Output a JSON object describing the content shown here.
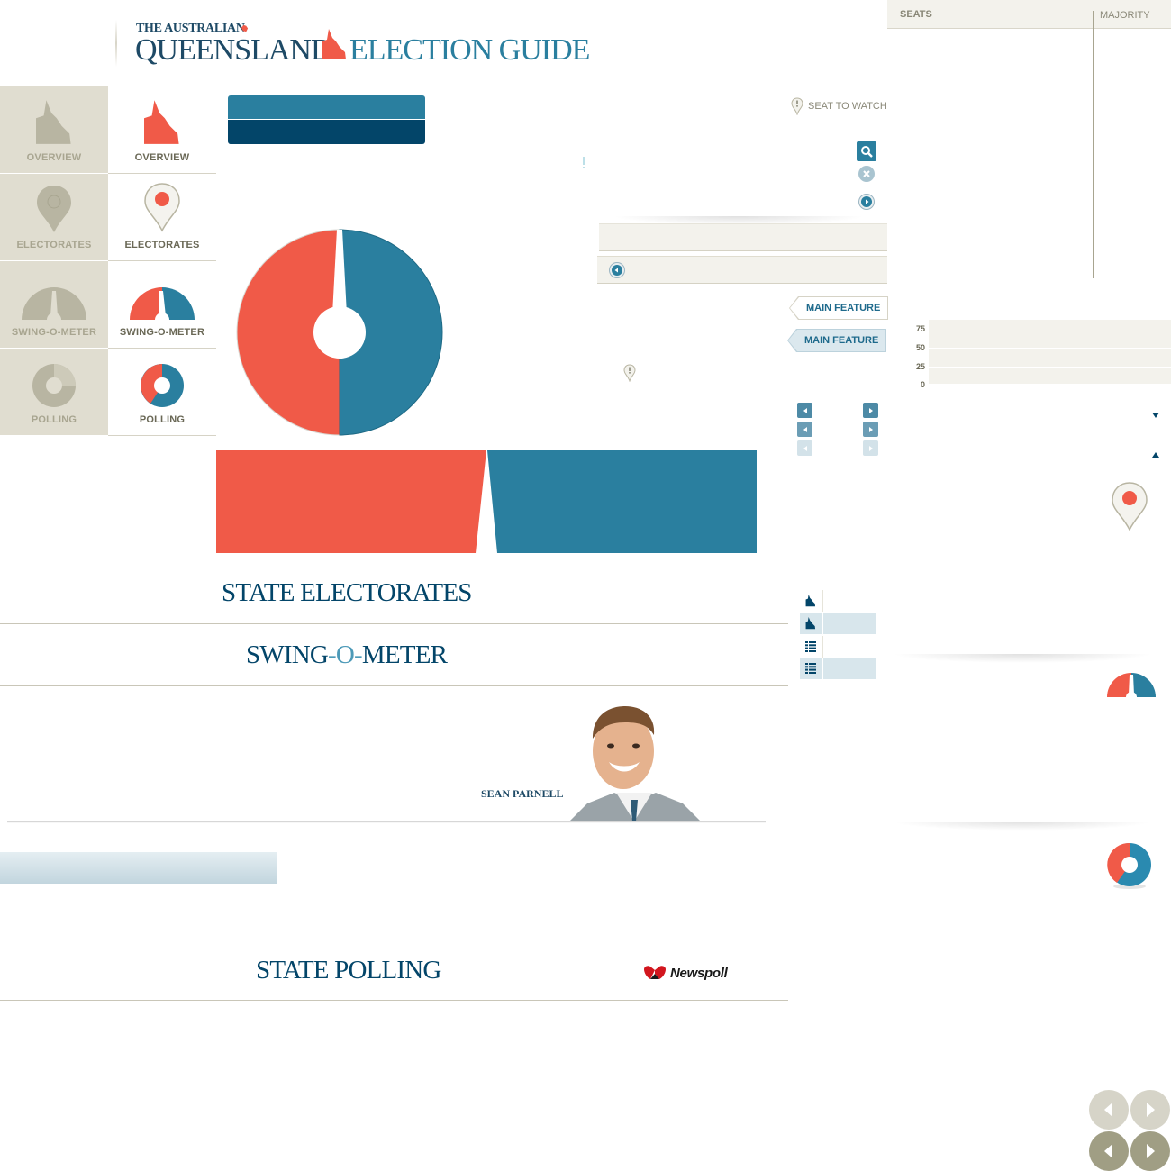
{
  "header": {
    "publication": "THE AUSTRALIAN",
    "title_main": "QUEENSLAND",
    "title_sub": "ELECTION GUIDE"
  },
  "nav": {
    "inactive": [
      {
        "label": "OVERVIEW",
        "icon": "queensland-map-icon"
      },
      {
        "label": "ELECTORATES",
        "icon": "map-pin-icon"
      },
      {
        "label": "SWING-O-METER",
        "icon": "swing-meter-icon"
      },
      {
        "label": "POLLING",
        "icon": "donut-chart-icon"
      }
    ],
    "active": [
      {
        "label": "OVERVIEW",
        "icon": "queensland-map-icon"
      },
      {
        "label": "ELECTORATES",
        "icon": "map-pin-icon"
      },
      {
        "label": "SWING-O-METER",
        "icon": "swing-meter-icon"
      },
      {
        "label": "POLLING",
        "icon": "donut-chart-icon"
      }
    ]
  },
  "legend": {
    "seat_to_watch": "SEAT TO WATCH"
  },
  "features": {
    "tab_1": "MAIN FEATURE",
    "tab_2": "MAIN FEATURE"
  },
  "seats_panel": {
    "seats_label": "SEATS",
    "majority_label": "MAJORITY",
    "ticks": [
      "75",
      "50",
      "25",
      "0"
    ]
  },
  "sections": {
    "electorates_title": "STATE ELECTORATES",
    "swing_title_a": "SWING",
    "swing_title_b": "-O-",
    "swing_title_c": "METER",
    "polling_title": "STATE POLLING"
  },
  "author": {
    "name": "SEAN PARNELL"
  },
  "newspoll": {
    "label": "Newspoll"
  },
  "colors": {
    "red": "#f05a48",
    "teal": "#2a7f9f",
    "navy": "#034569",
    "beige": "#e0ddd0"
  }
}
